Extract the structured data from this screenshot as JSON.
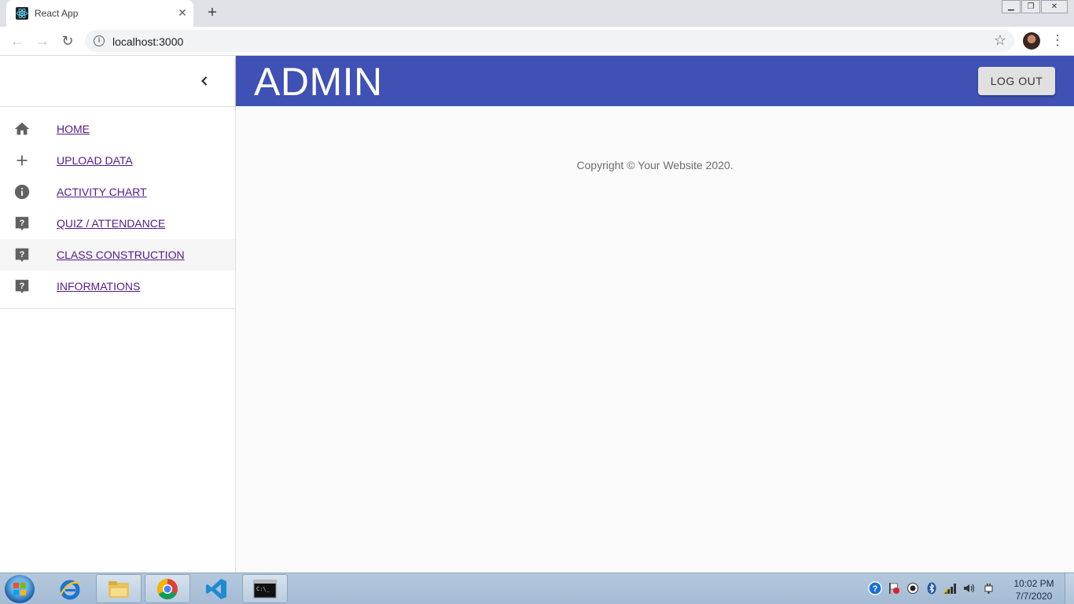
{
  "browser": {
    "tab_title": "React App",
    "url": "localhost:3000"
  },
  "header": {
    "title": "ADMIN",
    "logout_label": "LOG OUT",
    "color": "#3f51b5"
  },
  "sidebar": {
    "items": [
      {
        "label": "HOME",
        "icon": "home-icon"
      },
      {
        "label": "UPLOAD DATA",
        "icon": "plus-icon"
      },
      {
        "label": "ACTIVITY CHART",
        "icon": "info-icon"
      },
      {
        "label": "QUIZ / ATTENDANCE",
        "icon": "help-icon"
      },
      {
        "label": "CLASS CONSTRUCTION",
        "icon": "help-icon"
      },
      {
        "label": "INFORMATIONS",
        "icon": "help-icon"
      }
    ]
  },
  "main": {
    "copyright": "Copyright © Your Website 2020."
  },
  "taskbar": {
    "time": "10:02 PM",
    "date": "7/7/2020"
  }
}
